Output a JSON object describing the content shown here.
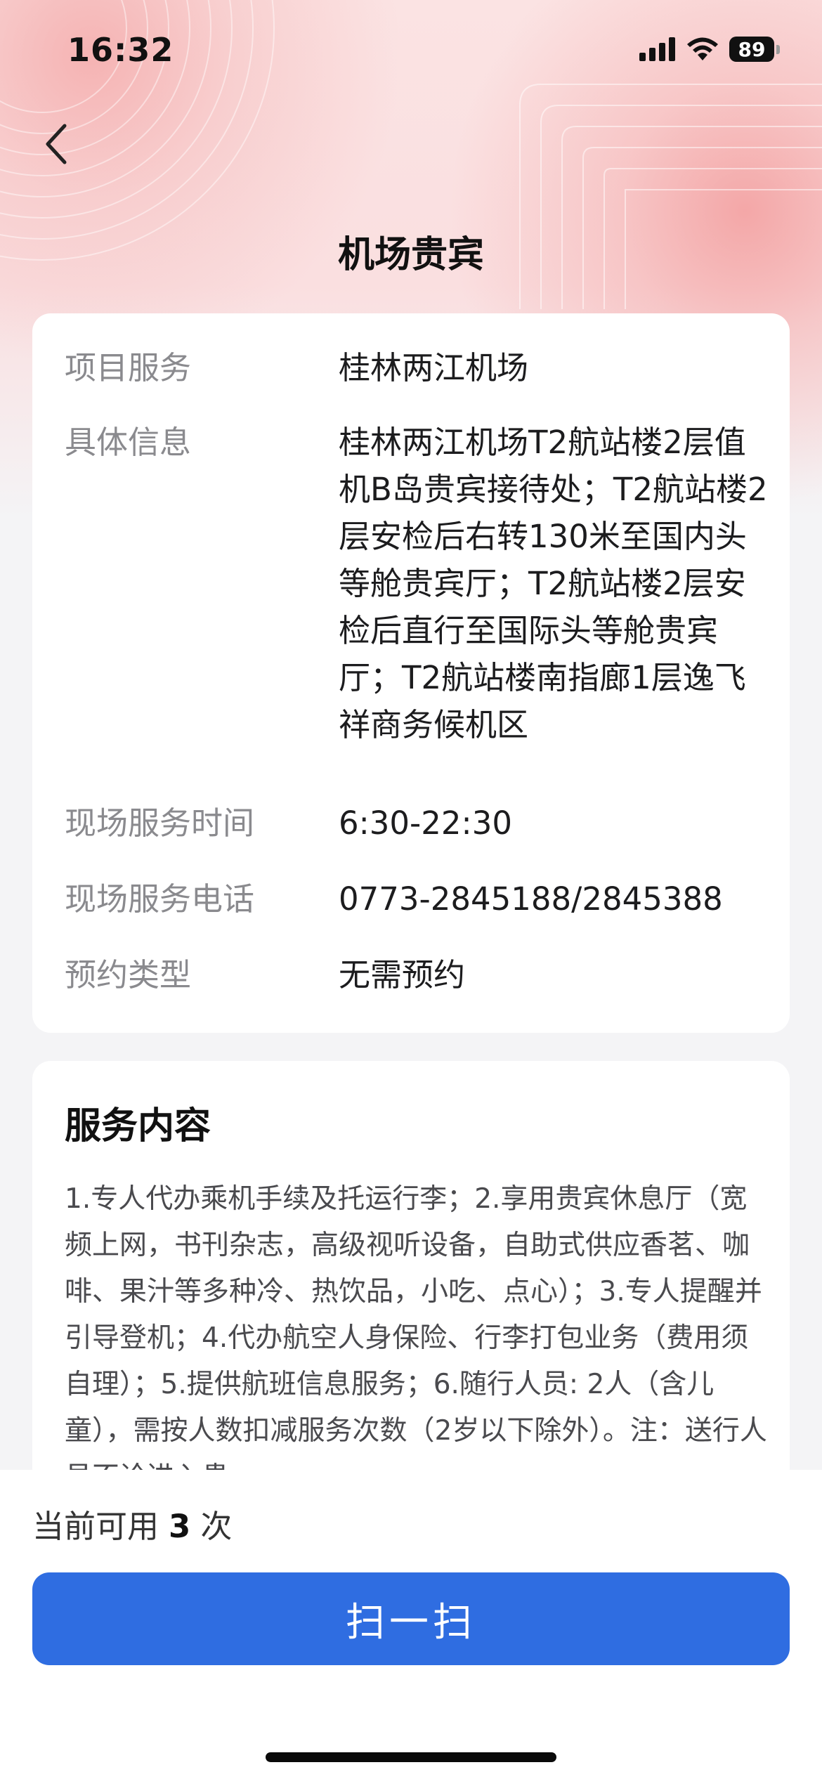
{
  "status_bar": {
    "time": "16:32",
    "battery": "89",
    "icons": [
      "signal-icon",
      "wifi-icon",
      "battery-icon"
    ]
  },
  "nav": {
    "back_icon": "chevron-left-icon",
    "title": "机场贵宾"
  },
  "info": {
    "rows": [
      {
        "label": "项目服务",
        "value": "桂林两江机场"
      },
      {
        "label": "具体信息",
        "value": "桂林两江机场T2航站楼2层值机B岛贵宾接待处；T2航站楼2层安检后右转130米至国内头等舱贵宾厅；T2航站楼2层安检后直行至国际头等舱贵宾厅；T2航站楼南指廊1层逸飞祥商务候机区"
      },
      {
        "label": "现场服务时间",
        "value": "6:30-22:30"
      },
      {
        "label": "现场服务电话",
        "value": "0773-2845188/2845388"
      },
      {
        "label": "预约类型",
        "value": "无需预约"
      }
    ]
  },
  "service_content": {
    "title": "服务内容",
    "text": "1.专人代办乘机手续及托运行李；2.享用贵宾休息厅（宽频上网，书刊杂志，高级视听设备，自助式供应香茗、咖啡、果汁等多种冷、热饮品，小吃、点心）；3.专人提醒并引导登机；4.代办航空人身保险、行李打包业务（费用须自理）；5.提供航班信息服务；6.随行人员: 2人（含儿童），需按人数扣减服务次数（2岁以下除外）。注：送行人员不论进入贵"
  },
  "footer": {
    "available_prefix": "当前可用",
    "available_count": "3",
    "available_suffix": "次",
    "scan_label": "扫一扫"
  },
  "colors": {
    "accent": "#2f6de1",
    "background": "#f4f4f6",
    "hero_pink": "#f2a8a8"
  }
}
